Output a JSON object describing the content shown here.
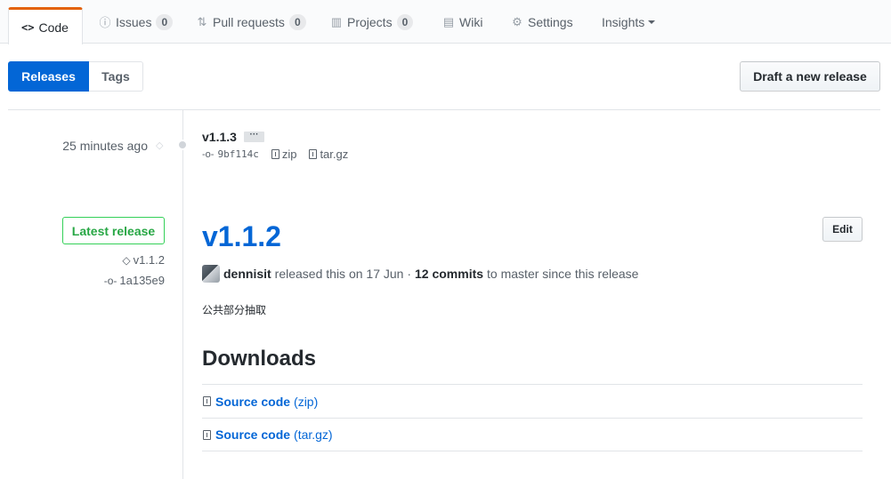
{
  "tabs": [
    {
      "label": "Code",
      "icon": "code-icon",
      "glyph": "<>",
      "selected": true
    },
    {
      "label": "Issues",
      "icon": "issue-icon",
      "glyph": "ⓘ",
      "count": "0"
    },
    {
      "label": "Pull requests",
      "icon": "pull-request-icon",
      "glyph": "⇅",
      "count": "0"
    },
    {
      "label": "Projects",
      "icon": "project-icon",
      "glyph": "▥",
      "count": "0"
    },
    {
      "label": "Wiki",
      "icon": "book-icon",
      "glyph": "▤"
    },
    {
      "label": "Settings",
      "icon": "gear-icon",
      "glyph": "⚙"
    },
    {
      "label": "Insights",
      "icon": "caret-down-icon"
    }
  ],
  "subnav": {
    "releases": "Releases",
    "tags": "Tags"
  },
  "draft_button": "Draft a new release",
  "release_1": {
    "time": "25 minutes ago",
    "name": "v1.1.3",
    "ellipsis": "···",
    "commit": "9bf114c",
    "zip": "zip",
    "targz": "tar.gz"
  },
  "release_2": {
    "badge": "Latest release",
    "tag": "v1.1.2",
    "commit": "1a135e9",
    "title": "v1.1.2",
    "edit": "Edit",
    "author": "dennisit",
    "released_text": "released this on 17 Jun ·",
    "commits": "12 commits",
    "since_text": "to master since this release",
    "body": "公共部分抽取",
    "downloads_heading": "Downloads",
    "downloads": [
      {
        "label": "Source code",
        "format": "(zip)"
      },
      {
        "label": "Source code",
        "format": "(tar.gz)"
      }
    ]
  },
  "colors": {
    "accent": "#0366d6",
    "selected_tab_border": "#e36209",
    "latest_green": "#28a745"
  }
}
